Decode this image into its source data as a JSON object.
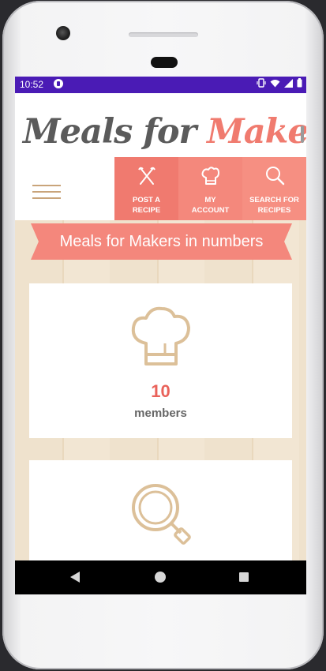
{
  "status": {
    "time": "10:52"
  },
  "header": {
    "logo_part1": "Meals for ",
    "logo_part2": "Makers"
  },
  "nav": {
    "items": [
      {
        "label_line1": "POST A",
        "label_line2": "RECIPE",
        "icon": "fork-knife-icon"
      },
      {
        "label_line1": "MY",
        "label_line2": "ACCOUNT",
        "icon": "chef-hat-icon"
      },
      {
        "label_line1": "SEARCH FOR",
        "label_line2": "RECIPES",
        "icon": "search-icon"
      }
    ]
  },
  "main": {
    "ribbon_title": "Meals for Makers in numbers",
    "stats": [
      {
        "value": "10",
        "label": "members",
        "icon": "chef-hat-icon"
      },
      {
        "icon": "frying-pan-icon"
      }
    ]
  },
  "colors": {
    "statusbar": "#4a1bb5",
    "accent": "#f07a6f",
    "gold": "#c9a47a",
    "value_red": "#e9625a"
  }
}
